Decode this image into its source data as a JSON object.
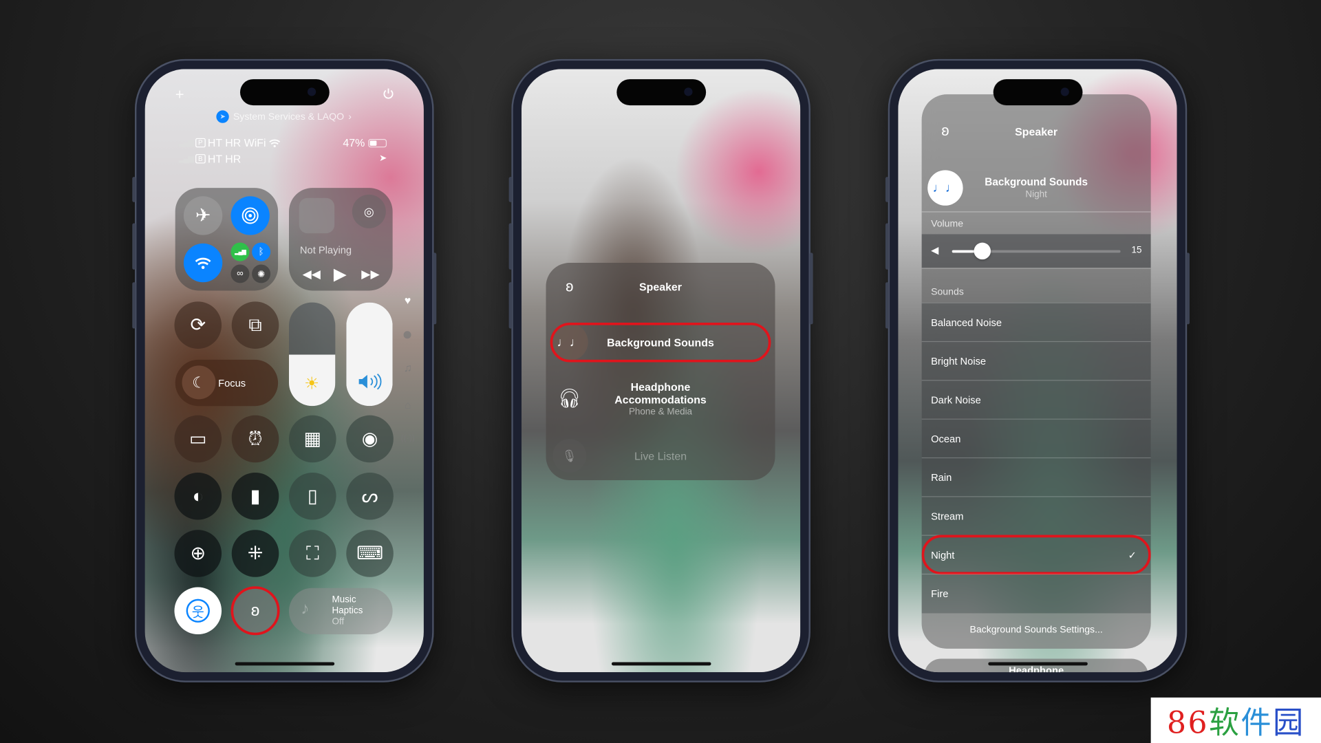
{
  "phone1": {
    "location_banner": "System Services & LAQO",
    "location_chevron": "›",
    "sim1": {
      "badge": "P",
      "carrier": "HT HR WiFi"
    },
    "sim2": {
      "badge": "B",
      "carrier": "HT HR"
    },
    "battery_percent": "47%",
    "battery_level": 0.47,
    "connectivity": {
      "airplane": "off",
      "airdrop": "on",
      "wifi": "on",
      "cellular": "on",
      "bluetooth": "on"
    },
    "media": {
      "status": "Not Playing"
    },
    "focus_label": "Focus",
    "brightness_level": 0.5,
    "volume_level": 1.0,
    "music_haptics": {
      "line1": "Music",
      "line2": "Haptics",
      "state": "Off"
    },
    "icons": [
      "plus-icon",
      "power-icon",
      "screen-rotation-lock-icon",
      "screen-mirroring-icon",
      "low-power-icon",
      "alarm-icon",
      "calculator-icon",
      "screen-record-icon",
      "dark-mode-icon",
      "flashlight-icon",
      "remote-icon",
      "shazam-icon",
      "magnifier-icon",
      "reduce-motion-icon",
      "code-scanner-icon",
      "type-to-siri-icon",
      "accessibility-icon",
      "hearing-icon"
    ]
  },
  "phone2": {
    "menu": {
      "title": "Speaker",
      "items": [
        {
          "label": "Background Sounds",
          "icon": "music-notes-icon",
          "highlighted": true
        },
        {
          "label_line1": "Headphone",
          "label_line2": "Accommodations",
          "subtitle": "Phone & Media",
          "icon": "headphones-icon"
        },
        {
          "label": "Live Listen",
          "icon": "microphone-icon",
          "disabled": true
        }
      ]
    }
  },
  "phone3": {
    "panel": {
      "title": "Speaker",
      "now": {
        "title": "Background Sounds",
        "subtitle": "Night"
      },
      "volume_label": "Volume",
      "volume_value": "15",
      "volume_fraction": 0.18,
      "sounds_label": "Sounds",
      "sounds": [
        "Balanced Noise",
        "Bright Noise",
        "Dark Noise",
        "Ocean",
        "Rain",
        "Stream",
        "Night",
        "Fire"
      ],
      "selected": "Night",
      "checkmark": "✓",
      "settings_link": "Background Sounds Settings...",
      "next_card": "Headphone"
    }
  },
  "watermark": {
    "text": "86软件园",
    "colors": [
      "#e02020",
      "#e02020",
      "#2aa040",
      "#2a8fd8",
      "#2a50c8",
      "#9a40b0"
    ]
  },
  "colors": {
    "accent_blue": "#0a84ff",
    "highlight_red": "#e0141c",
    "cellular_green": "#30c04a"
  }
}
